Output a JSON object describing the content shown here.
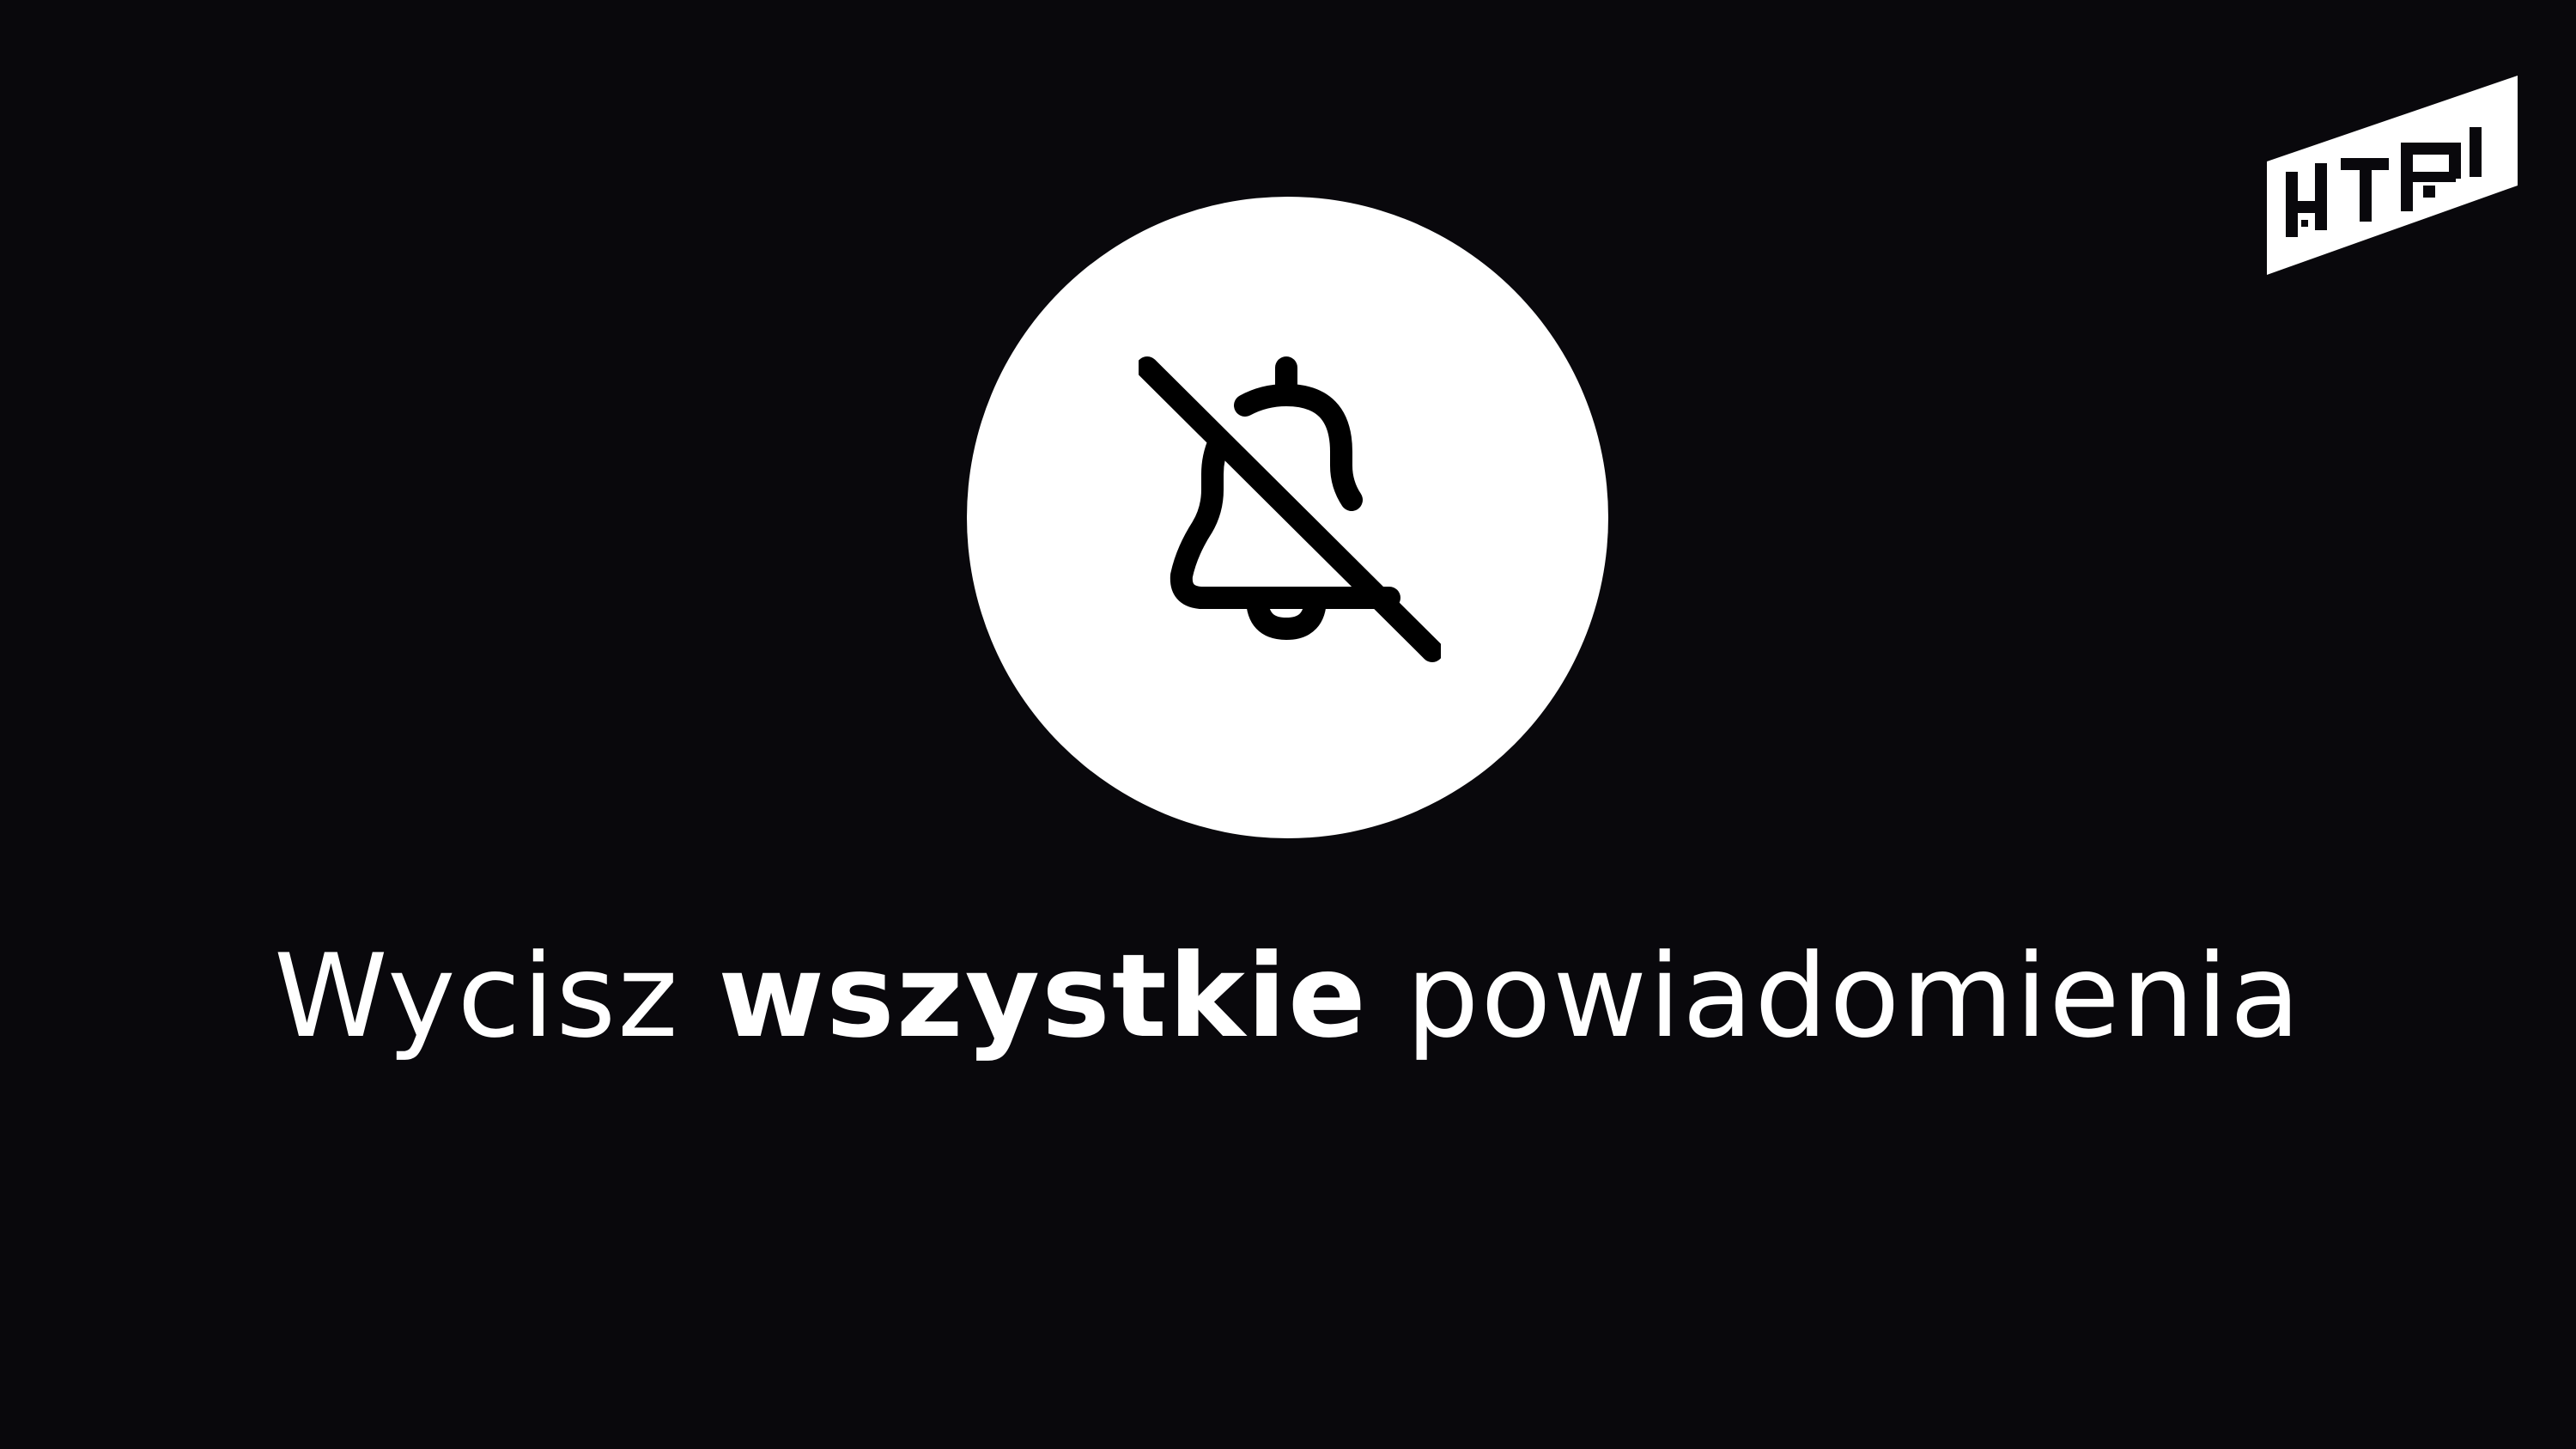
{
  "logo": {
    "text": "HTB",
    "icon": "htb-logo"
  },
  "icon": {
    "name": "bell-off-icon"
  },
  "caption": {
    "part1": "Wycisz ",
    "bold": "wszystkie",
    "part2": " powiadomienia"
  },
  "colors": {
    "background": "#09080c",
    "foreground": "#ffffff",
    "icon": "#000000"
  }
}
